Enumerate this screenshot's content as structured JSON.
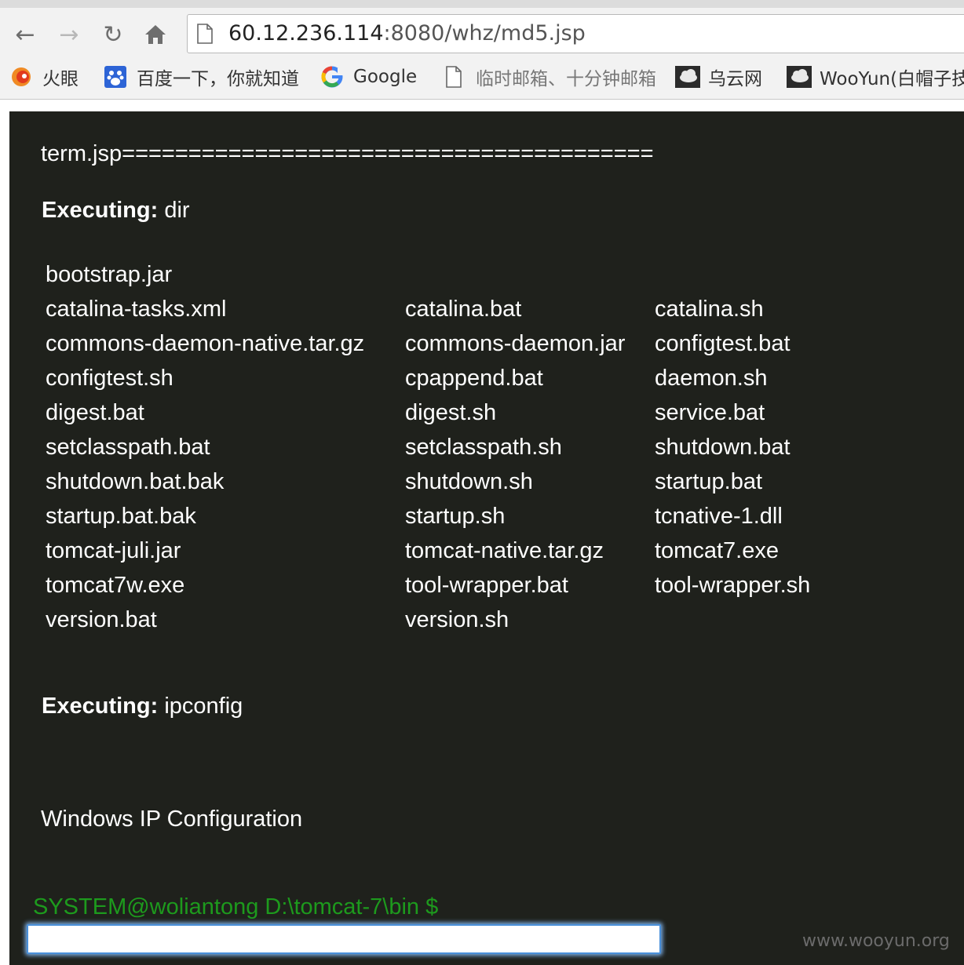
{
  "browser": {
    "url_host": "60.12.236.114",
    "url_rest": ":8080/whz/md5.jsp",
    "bookmarks": [
      {
        "label": "火眼",
        "icon": "huoyan-icon"
      },
      {
        "label": "百度一下，你就知道",
        "icon": "baidu-paw-icon"
      },
      {
        "label": "Google",
        "icon": "google-icon"
      },
      {
        "label": "临时邮箱、十分钟邮箱",
        "icon": "page-icon"
      },
      {
        "label": "乌云网",
        "icon": "wooyun-cloud-icon"
      },
      {
        "label": "WooYun(白帽子技",
        "icon": "wooyun-cloud-icon"
      }
    ]
  },
  "terminal": {
    "title": "term.jsp========================================",
    "exec_label": "Executing:",
    "commands": [
      "dir",
      "ipconfig"
    ],
    "dir_listing": [
      [
        "bootstrap.jar",
        "",
        ""
      ],
      [
        "catalina-tasks.xml",
        "catalina.bat",
        "catalina.sh"
      ],
      [
        "commons-daemon-native.tar.gz",
        "commons-daemon.jar",
        "configtest.bat"
      ],
      [
        "configtest.sh",
        "cpappend.bat",
        "daemon.sh"
      ],
      [
        "digest.bat",
        "digest.sh",
        "service.bat"
      ],
      [
        "setclasspath.bat",
        "setclasspath.sh",
        "shutdown.bat"
      ],
      [
        "shutdown.bat.bak",
        "shutdown.sh",
        "startup.bat"
      ],
      [
        "startup.bat.bak",
        "startup.sh",
        "tcnative-1.dll"
      ],
      [
        "tomcat-juli.jar",
        "tomcat-native.tar.gz",
        "tomcat7.exe"
      ],
      [
        "tomcat7w.exe",
        "tool-wrapper.bat",
        "tool-wrapper.sh"
      ],
      [
        "version.bat",
        "version.sh",
        ""
      ]
    ],
    "ipconfig_output": "Windows IP Configuration",
    "prompt": "SYSTEM@woliantong D:\\tomcat-7\\bin $",
    "input_value": "",
    "prompt_color": "#1d9a1d",
    "background_color": "#1f211c"
  },
  "watermark": "www.wooyun.org"
}
